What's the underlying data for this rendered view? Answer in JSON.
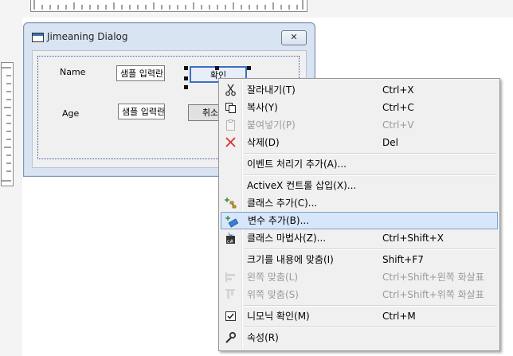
{
  "dialog": {
    "title": "Jimeaning Dialog",
    "close_label": "✕",
    "name_label": "Name",
    "age_label": "Age",
    "name_edit_value": "샘플 입력란",
    "age_edit_value": "샘플 입력란",
    "ok_button_label": "확인",
    "cancel_button_label": "취소"
  },
  "menu": {
    "items": [
      {
        "label": "잘라내기(T)",
        "shortcut": "Ctrl+X",
        "icon": "scissors-icon",
        "disabled": false
      },
      {
        "label": "복사(Y)",
        "shortcut": "Ctrl+C",
        "icon": "copy-icon",
        "disabled": false
      },
      {
        "label": "붙여넣기(P)",
        "shortcut": "Ctrl+V",
        "icon": "paste-icon",
        "disabled": true
      },
      {
        "label": "삭제(D)",
        "shortcut": "Del",
        "icon": "delete-icon",
        "disabled": false
      },
      {
        "label": "이벤트 처리기 추가(A)...",
        "shortcut": "",
        "icon": "",
        "disabled": false
      },
      {
        "label": "ActiveX 컨트롤 삽입(X)...",
        "shortcut": "",
        "icon": "",
        "disabled": false
      },
      {
        "label": "클래스 추가(C)...",
        "shortcut": "",
        "icon": "add-class-icon",
        "disabled": false
      },
      {
        "label": "변수 추가(B)...",
        "shortcut": "",
        "icon": "add-variable-icon",
        "disabled": false,
        "highlighted": true
      },
      {
        "label": "클래스 마법사(Z)...",
        "shortcut": "Ctrl+Shift+X",
        "icon": "class-wizard-icon",
        "disabled": false
      },
      {
        "label": "크기를 내용에 맞춤(I)",
        "shortcut": "Shift+F7",
        "icon": "",
        "disabled": false
      },
      {
        "label": "왼쪽 맞춤(L)",
        "shortcut": "Ctrl+Shift+왼쪽 화살표",
        "icon": "align-left-icon",
        "disabled": true
      },
      {
        "label": "위쪽 맞춤(S)",
        "shortcut": "Ctrl+Shift+위쪽 화살표",
        "icon": "align-top-icon",
        "disabled": true
      },
      {
        "label": "니모닉 확인(M)",
        "shortcut": "Ctrl+M",
        "icon": "check-mnemonics-icon",
        "disabled": false
      },
      {
        "label": "속성(R)",
        "shortcut": "",
        "icon": "wrench-icon",
        "disabled": false
      }
    ]
  },
  "colors": {
    "highlight_bg": "#d8e6fb",
    "highlight_border": "#7da2ce",
    "delete_icon": "#d9342b"
  }
}
